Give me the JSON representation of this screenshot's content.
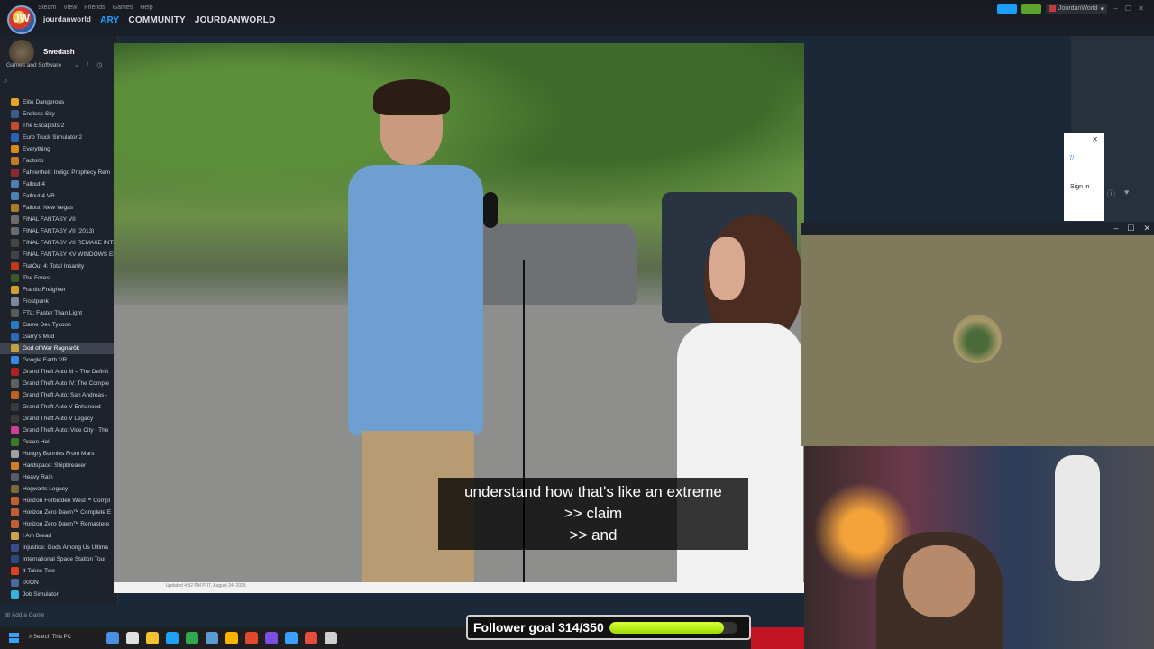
{
  "window": {
    "logo_text": "JW",
    "menu": [
      "Steam",
      "View",
      "Friends",
      "Games",
      "Help"
    ],
    "nav": [
      {
        "label": "jourdanworld",
        "active": false
      },
      {
        "label": "ARY",
        "active": true
      },
      {
        "label": "COMMUNITY",
        "active": false
      },
      {
        "label": "JOURDANWORLD",
        "active": false
      }
    ],
    "user": "JourdanWorld",
    "accent": "#1a9fff"
  },
  "sidebar": {
    "username": "Swedash",
    "category": "Games and Software",
    "add_game": "Add a Game",
    "selected": "God of War Ragnarök",
    "games": [
      {
        "name": "Elite Dangerous",
        "color": "#e6a421"
      },
      {
        "name": "Endless Sky",
        "color": "#3b5a8a"
      },
      {
        "name": "The Escapists 2",
        "color": "#c74b2a"
      },
      {
        "name": "Euro Truck Simulator 2",
        "color": "#2b62b0"
      },
      {
        "name": "Everything",
        "color": "#d98a1c"
      },
      {
        "name": "Factorio",
        "color": "#c57a2a"
      },
      {
        "name": "Fahrenheit: Indigo Prophecy Rem",
        "color": "#8a2b2b"
      },
      {
        "name": "Fallout 4",
        "color": "#4e7fb0"
      },
      {
        "name": "Fallout 4 VR",
        "color": "#4e7fb0"
      },
      {
        "name": "Fallout: New Vegas",
        "color": "#b07a2e"
      },
      {
        "name": "FINAL FANTASY VII",
        "color": "#6b6b6b"
      },
      {
        "name": "FINAL FANTASY VII (2013)",
        "color": "#6b6b6b"
      },
      {
        "name": "FINAL FANTASY VII REMAKE INTE",
        "color": "#444"
      },
      {
        "name": "FINAL FANTASY XV WINDOWS EI",
        "color": "#444"
      },
      {
        "name": "FlatOut 4: Total Insanity",
        "color": "#c03a1a"
      },
      {
        "name": "The Forest",
        "color": "#3a5a2a"
      },
      {
        "name": "Frantic Freighter",
        "color": "#d0a030"
      },
      {
        "name": "Frostpunk",
        "color": "#7a8a9a"
      },
      {
        "name": "FTL: Faster Than Light",
        "color": "#5a5a5a"
      },
      {
        "name": "Game Dev Tycoon",
        "color": "#2a7ac0"
      },
      {
        "name": "Garry's Mod",
        "color": "#2a6ab0"
      },
      {
        "name": "God of War Ragnarök",
        "color": "#c0a040"
      },
      {
        "name": "Google Earth VR",
        "color": "#3a8ae0"
      },
      {
        "name": "Grand Theft Auto III – The Definit",
        "color": "#b02020"
      },
      {
        "name": "Grand Theft Auto IV: The Comple",
        "color": "#606060"
      },
      {
        "name": "Grand Theft Auto: San Andreas -",
        "color": "#c06020"
      },
      {
        "name": "Grand Theft Auto V Enhanced",
        "color": "#3a3a3a"
      },
      {
        "name": "Grand Theft Auto V Legacy",
        "color": "#3a3a3a"
      },
      {
        "name": "Grand Theft Auto: Vice City - The",
        "color": "#d04090"
      },
      {
        "name": "Green Hell",
        "color": "#3a7a2a"
      },
      {
        "name": "Hungry Bunnies From Mars",
        "color": "#a0a0a0"
      },
      {
        "name": "Hardspace: Shipbreaker",
        "color": "#d08020"
      },
      {
        "name": "Heavy Rain",
        "color": "#5a5a6a"
      },
      {
        "name": "Hogwarts Legacy",
        "color": "#7a6a3a"
      },
      {
        "name": "Horizon Forbidden West™ Compl",
        "color": "#c06030"
      },
      {
        "name": "Horizon Zero Dawn™ Complete E",
        "color": "#c06030"
      },
      {
        "name": "Horizon Zero Dawn™ Remastere",
        "color": "#c06030"
      },
      {
        "name": "I Am Bread",
        "color": "#d0a050"
      },
      {
        "name": "Injustice: Gods Among Us Ultima",
        "color": "#3a4a8a"
      },
      {
        "name": "International Space Station Tour",
        "color": "#2a4a7a"
      },
      {
        "name": "It Takes Two",
        "color": "#e04020"
      },
      {
        "name": "IXION",
        "color": "#4a6a9a"
      },
      {
        "name": "Job Simulator",
        "color": "#3ab0e0"
      }
    ]
  },
  "video": {
    "caption_lines": [
      "understand how that's like an extreme",
      ">> claim",
      ">> and"
    ],
    "updated_text": "Updated 4:52 PM PDT, August 24, 2025"
  },
  "mini_window": {
    "sign_in": "Sign in",
    "close": "✕",
    "code": "7/"
  },
  "overlay": {
    "minimize": "–",
    "maximize": "☐",
    "close": "✕"
  },
  "follower_goal": {
    "label": "Follower goal 314/350",
    "current": 314,
    "target": 350,
    "bar_color": "#b5f000"
  },
  "taskbar": {
    "search_placeholder": "Search This PC",
    "apps": [
      "#4a90e2",
      "#e0e0e0",
      "#f2c230",
      "#1da1f2",
      "#2fa84f",
      "#5b9bd5",
      "#ffb400",
      "#e04a2a",
      "#7a4fe0",
      "#3aa0ff",
      "#e84c3d",
      "#d0d0d0"
    ]
  }
}
